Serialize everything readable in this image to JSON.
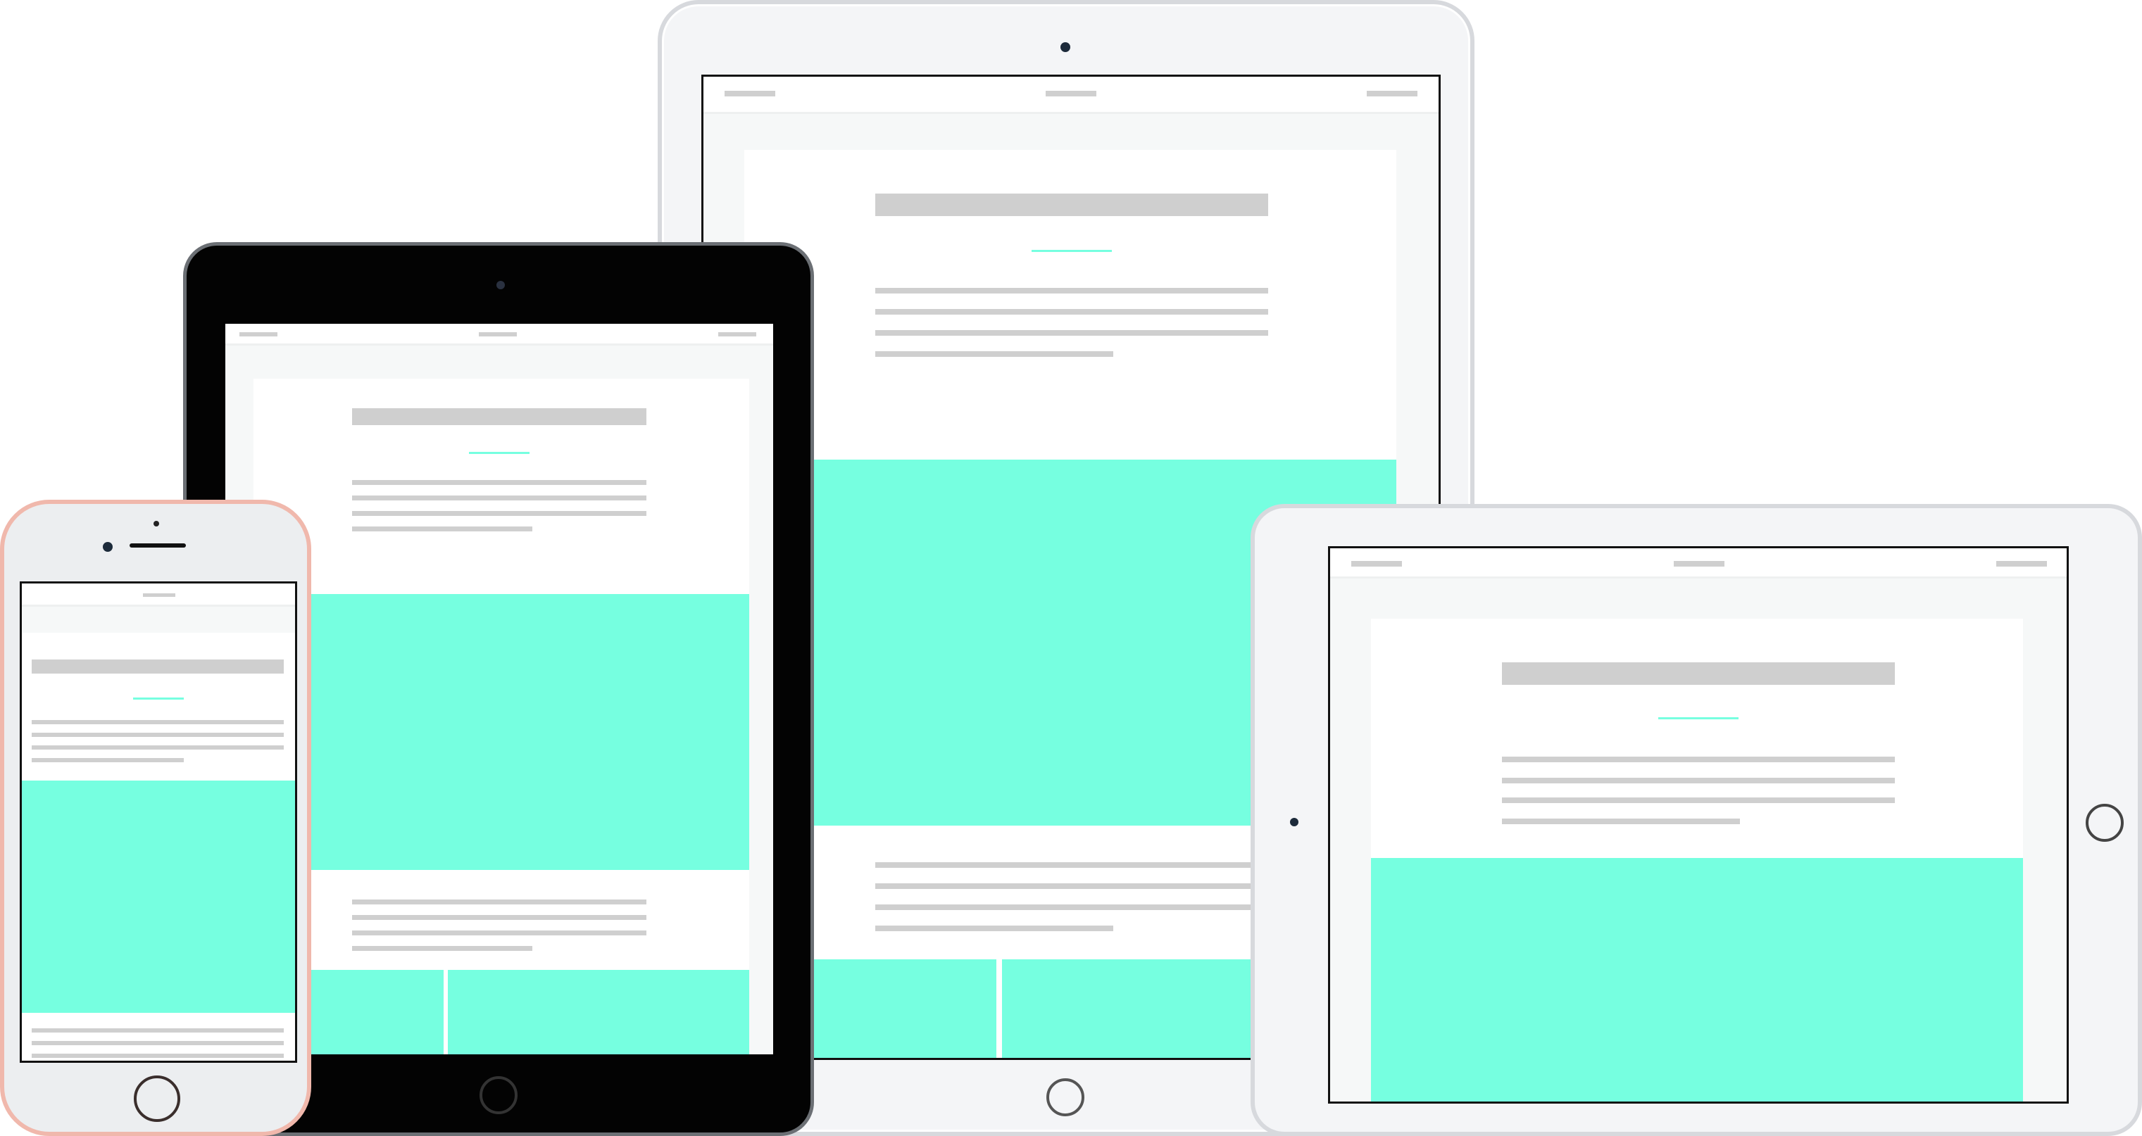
{
  "scene": {
    "devices": [
      {
        "name": "ipad-silver-portrait",
        "frame_color": "#f4f5f7"
      },
      {
        "name": "ipad-black",
        "frame_color": "#030303"
      },
      {
        "name": "iphone",
        "frame_color": "#eceef0",
        "accent": "#f0b8ac"
      },
      {
        "name": "ipad-silver-landscape",
        "frame_color": "#f4f5f7"
      }
    ],
    "colors": {
      "teal": "#76ffe0",
      "placeholder_bar": "#cfcfcf",
      "screen_bg": "#f6f8f8"
    },
    "icons": {
      "home_button": "home-button-icon",
      "camera": "camera-icon",
      "speaker": "speaker-icon"
    }
  }
}
